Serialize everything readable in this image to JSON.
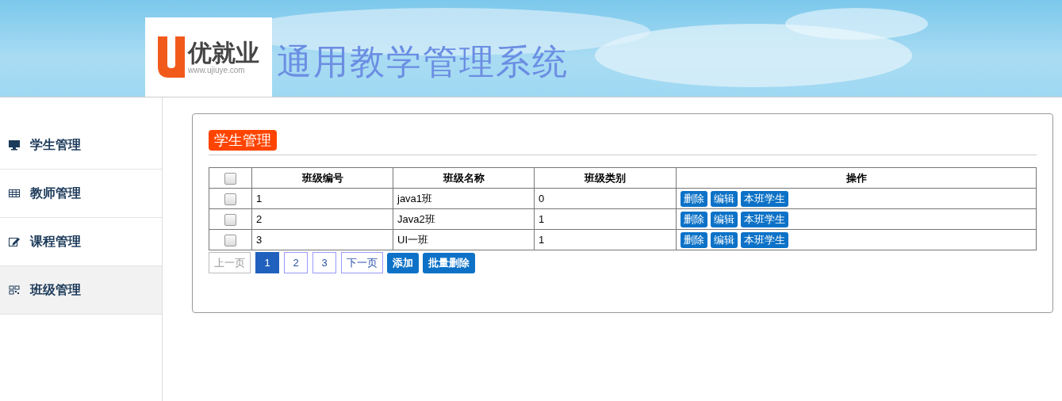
{
  "header": {
    "logo_brand": "优就业",
    "logo_url": "www.ujiuye.com",
    "title": "通用教学管理系统"
  },
  "sidebar": {
    "items": [
      {
        "label": "学生管理",
        "selected": false
      },
      {
        "label": "教师管理",
        "selected": false
      },
      {
        "label": "课程管理",
        "selected": false
      },
      {
        "label": "班级管理",
        "selected": true
      }
    ]
  },
  "panel": {
    "heading": "学生管理",
    "table": {
      "select_all": {
        "checked": false
      },
      "columns": [
        "班级编号",
        "班级名称",
        "班级类别",
        "操作"
      ],
      "rows": [
        {
          "checked": false,
          "cells": [
            "1",
            "java1班",
            "0"
          ],
          "actions": [
            "删除",
            "编辑",
            "本班学生"
          ]
        },
        {
          "checked": false,
          "cells": [
            "2",
            "Java2班",
            "1"
          ],
          "actions": [
            "删除",
            "编辑",
            "本班学生"
          ]
        },
        {
          "checked": false,
          "cells": [
            "3",
            "UI一班",
            "1"
          ],
          "actions": [
            "删除",
            "编辑",
            "本班学生"
          ]
        }
      ]
    },
    "pagination": {
      "prev": {
        "label": "上一页",
        "disabled": true
      },
      "pages": [
        {
          "label": "1",
          "selected": true
        },
        {
          "label": "2",
          "selected": false
        },
        {
          "label": "3",
          "selected": false
        }
      ],
      "next": {
        "label": "下一页",
        "disabled": false
      }
    },
    "buttons": [
      "添加",
      "批量删除"
    ]
  }
}
